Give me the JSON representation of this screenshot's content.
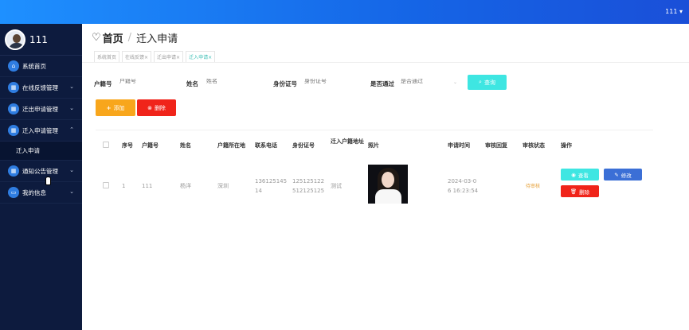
{
  "topbar": {
    "user": "111 ▾"
  },
  "sidebar": {
    "username": "111",
    "items": [
      {
        "label": "系统首页",
        "icon": "home-icon"
      },
      {
        "label": "在线反馈管理",
        "icon": "grid-icon"
      },
      {
        "label": "迁出申请管理",
        "icon": "grid-icon"
      },
      {
        "label": "迁入申请管理",
        "icon": "grid-icon"
      },
      {
        "label": "通知公告管理",
        "icon": "grid-icon"
      },
      {
        "label": "我的信息",
        "icon": "card-icon"
      }
    ],
    "sub_item": "迁入申请"
  },
  "header": {
    "home": "首页",
    "current": "迁入申请"
  },
  "tags": [
    "系统首页",
    "在线反馈×",
    "迁出申请×",
    "迁入申请×"
  ],
  "search": {
    "household_label": "户籍号",
    "household_placeholder": "户籍号",
    "name_label": "姓名",
    "name_placeholder": "姓名",
    "id_label": "身份证号",
    "id_placeholder": "身份证号",
    "approved_label": "是否通过",
    "approved_placeholder": "是否通过",
    "query_button": "查询"
  },
  "actions": {
    "add": "添加",
    "delete": "删除"
  },
  "table": {
    "headers": [
      "序号",
      "户籍号",
      "姓名",
      "户籍所在地",
      "联系电话",
      "身份证号",
      "迁入户籍地址",
      "照片",
      "申请时间",
      "审核回复",
      "审核状态",
      "操作"
    ],
    "rows": [
      {
        "index": "1",
        "household": "111",
        "name": "杨洋",
        "location": "深圳",
        "phone_1": "136125145",
        "phone_2": "14",
        "id_1": "125125122",
        "id_2": "512125125",
        "address": "测试",
        "time_1": "2024-03-0",
        "time_2": "6 16:23:54",
        "reply": "",
        "status": "待审核",
        "view": "查看",
        "edit": "修改",
        "delete": "删除"
      }
    ]
  },
  "colors": {
    "topbar": "#1565e6",
    "sidebar": "#0d1b3e",
    "cyan": "#3ee6e2",
    "orange": "#f8a61c",
    "red": "#f0241a",
    "blue": "#3b6fd6"
  }
}
